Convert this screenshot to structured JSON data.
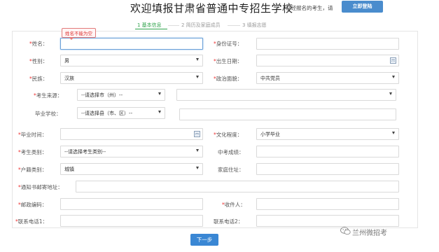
{
  "header": {
    "title": "欢迎填报甘肃省普通中专招生学校",
    "login_hint": "已经报名的考生，请",
    "login_button": "立即登陆"
  },
  "steps": [
    {
      "label": "1 基本信息",
      "active": true
    },
    {
      "label": "2 简历及家庭成员",
      "active": false
    },
    {
      "label": "3 填报志愿",
      "active": false
    }
  ],
  "validation": {
    "name_error": "姓名不能为空"
  },
  "form": {
    "required_mark": "*",
    "name": {
      "label": "姓名：",
      "value": ""
    },
    "id_number": {
      "label": "身份证号：",
      "value": ""
    },
    "gender": {
      "label": "性别：",
      "value": "男"
    },
    "birth_date": {
      "label": "出生日期：",
      "value": ""
    },
    "ethnicity": {
      "label": "民族：",
      "value": "汉族"
    },
    "political_status": {
      "label": "政治面貌：",
      "value": "中共党员"
    },
    "origin": {
      "label": "考生来源：",
      "value": "--请选择市（州）--",
      "detail_value": ""
    },
    "graduate_school": {
      "label": "毕业学校：",
      "value": "--请选择县（市、区）--",
      "detail_value": ""
    },
    "graduation_time": {
      "label": "毕业时间：",
      "value": ""
    },
    "education_level": {
      "label": "文化程度：",
      "value": "小学毕业"
    },
    "candidate_type": {
      "label": "考生类别：",
      "value": "--请选择考生类别--"
    },
    "exam_score": {
      "label": "中考成绩：",
      "value": ""
    },
    "household_type": {
      "label": "户籍类别：",
      "value": "城镇"
    },
    "home_address": {
      "label": "家庭住址：",
      "value": ""
    },
    "notice_address": {
      "label": "通知书邮寄地址：",
      "value": ""
    },
    "postal_code": {
      "label": "邮政编码：",
      "value": ""
    },
    "recipient": {
      "label": "收件人：",
      "value": ""
    },
    "phone1": {
      "label": "联系电话1：",
      "value": ""
    },
    "phone2": {
      "label": "联系电话2：",
      "value": ""
    }
  },
  "actions": {
    "next_button": "下一步"
  },
  "watermark": {
    "text": "兰州微招考",
    "icon": "wechat-icon"
  },
  "colors": {
    "accent": "#3a87d4",
    "step_active": "#2ea24a",
    "required": "#e33333",
    "error": "#d33333"
  }
}
